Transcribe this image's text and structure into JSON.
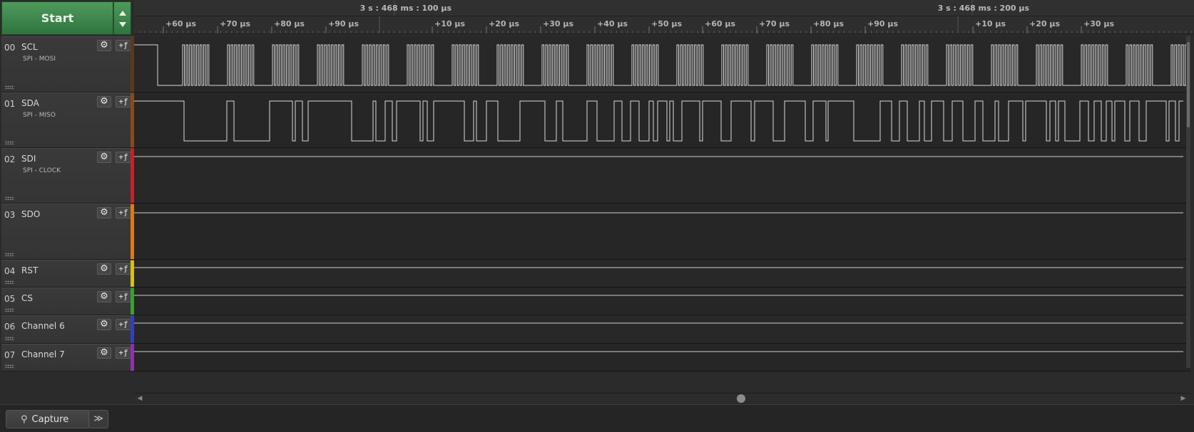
{
  "start_button": {
    "label": "Start"
  },
  "icons": {
    "gear": "gear-icon",
    "trigger": "trigger-icon",
    "spin_up": "triangle-up-icon",
    "spin_down": "triangle-down-icon",
    "capture": "capture-search-icon",
    "more": "double-chevron-icon"
  },
  "timeline": {
    "group_labels": [
      "3 s : 468 ms : 100 µs",
      "3 s : 468 ms : 200 µs"
    ],
    "ticks": [
      "+60 µs",
      "+70 µs",
      "+80 µs",
      "+90 µs",
      "+10 µs",
      "+20 µs",
      "+30 µs",
      "+40 µs",
      "+50 µs",
      "+60 µs",
      "+70 µs",
      "+80 µs",
      "+90 µs",
      "+10 µs",
      "+20 µs",
      "+30 µs"
    ]
  },
  "channels": [
    {
      "num": "00",
      "name": "SCL",
      "sub": "SPI - MOSI",
      "color": "#5a3a1e"
    },
    {
      "num": "01",
      "name": "SDA",
      "sub": "SPI - MISO",
      "color": "#8a4a1a"
    },
    {
      "num": "02",
      "name": "SDI",
      "sub": "SPI - CLOCK",
      "color": "#c8202a"
    },
    {
      "num": "03",
      "name": "SDO",
      "sub": "",
      "color": "#e07a10"
    },
    {
      "num": "04",
      "name": "RST",
      "sub": "",
      "color": "#d8c010"
    },
    {
      "num": "05",
      "name": "CS",
      "sub": "",
      "color": "#3aa030"
    },
    {
      "num": "06",
      "name": "Channel 6",
      "sub": "",
      "color": "#3040c0"
    },
    {
      "num": "07",
      "name": "Channel 7",
      "sub": "",
      "color": "#9030b0"
    }
  ],
  "channel_buttons": {
    "trigger_label": "+ƒ"
  },
  "bottom": {
    "capture_label": "Capture",
    "more_label": "≫"
  }
}
